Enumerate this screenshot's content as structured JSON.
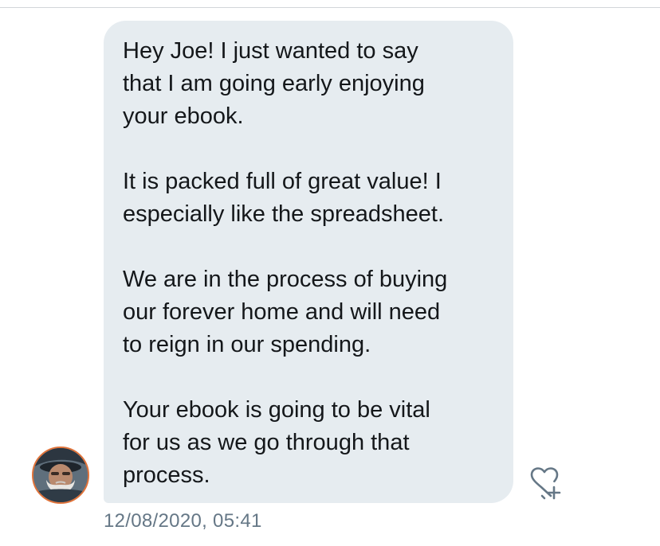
{
  "message": {
    "paragraphs": [
      "Hey Joe!  I just wanted to say\nthat I am going early enjoying\nyour ebook.",
      "It is packed full of great value!  I\nespecially like the spreadsheet.",
      "We are in the process of buying\nour forever home and will need\nto reign in our spending.",
      "Your ebook is going to be vital\nfor us as we go through that\nprocess."
    ],
    "timestamp": "12/08/2020, 05:41"
  },
  "sender": {
    "avatar_icon": "user-avatar",
    "avatar_border_color": "#e0733a"
  },
  "actions": {
    "like_icon": "heart-plus-icon"
  },
  "colors": {
    "bubble_background": "#e6ecf0",
    "text": "#14171a",
    "muted_text": "#657786"
  }
}
